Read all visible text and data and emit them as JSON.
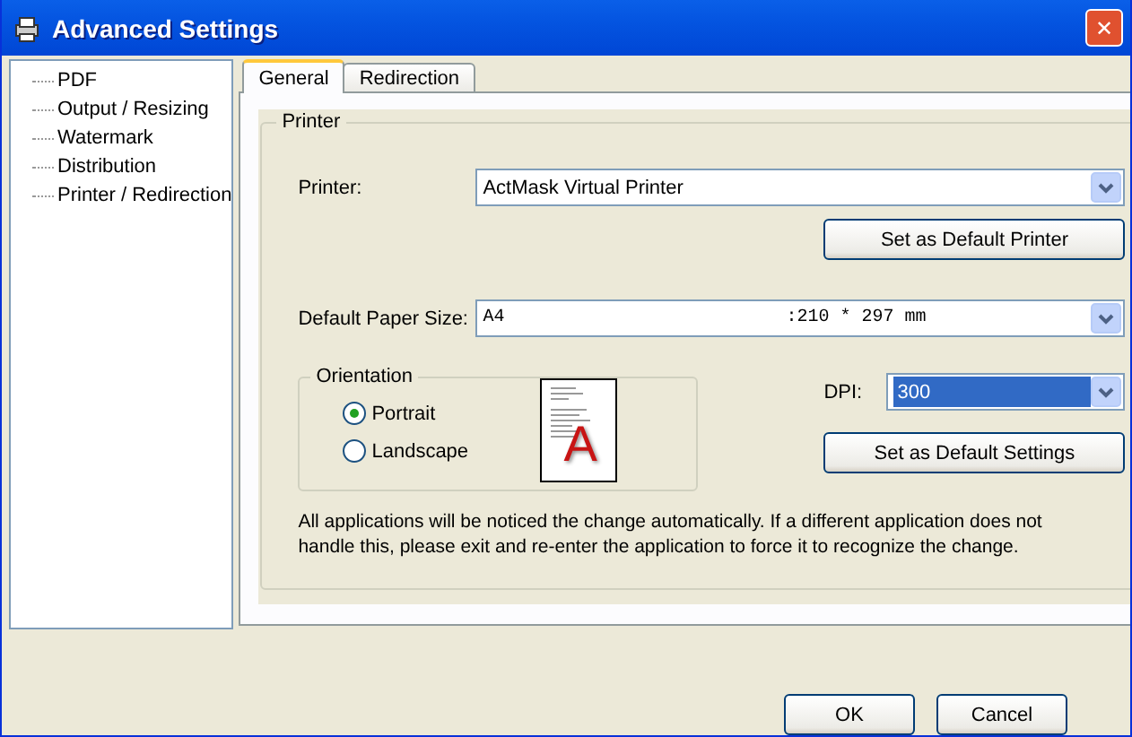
{
  "window": {
    "title": "Advanced Settings",
    "close": "✕"
  },
  "sidebar": {
    "items": [
      {
        "label": "PDF",
        "selected": false
      },
      {
        "label": "Output / Resizing",
        "selected": false
      },
      {
        "label": "Watermark",
        "selected": false
      },
      {
        "label": "Distribution",
        "selected": false
      },
      {
        "label": "Printer / Redirection",
        "selected": false
      }
    ]
  },
  "tabs": [
    {
      "label": "General",
      "selected": true
    },
    {
      "label": "Redirection",
      "selected": false
    }
  ],
  "printer_group": {
    "title": "Printer",
    "printer": {
      "label": "Printer:",
      "value": "ActMask Virtual Printer"
    },
    "default_printer_button": "Set as Default Printer",
    "paper_size": {
      "label": "Default Paper Size:",
      "value": "A4",
      "size": ":210 * 297 mm"
    },
    "orientation": {
      "title": "Orientation",
      "options": [
        {
          "label": "Portrait",
          "selected": true
        },
        {
          "label": "Landscape",
          "selected": false
        }
      ],
      "preview_letter": "A"
    },
    "dpi": {
      "label": "DPI:",
      "value": "300",
      "focused": true
    },
    "default_settings_button": "Set as Default Settings",
    "note": "All applications will be noticed the change automatically. If a different application does not handle this, please exit and re-enter the application to force it to recognize the change."
  },
  "buttons": [
    "OK",
    "Cancel"
  ]
}
